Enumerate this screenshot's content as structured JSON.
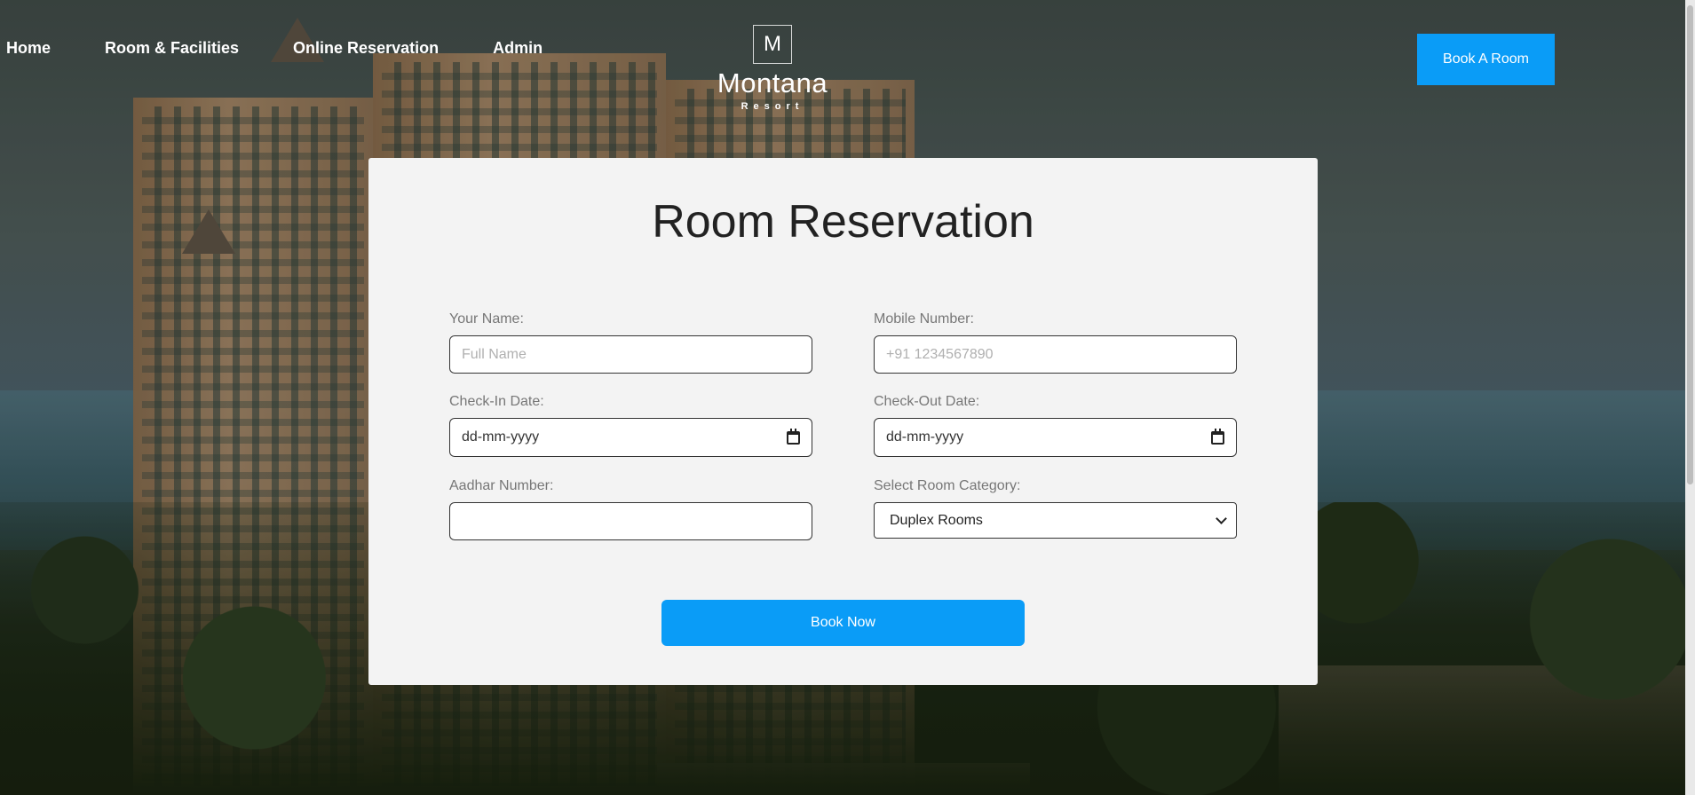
{
  "nav": {
    "items": [
      {
        "label": "Home"
      },
      {
        "label": "Room & Facilities"
      },
      {
        "label": "Online Reservation"
      },
      {
        "label": "Admin"
      }
    ]
  },
  "logo": {
    "mark": "M",
    "name": "Montana",
    "subtitle": "Resort"
  },
  "header": {
    "book_button_label": "Book A Room"
  },
  "form": {
    "title": "Room Reservation",
    "name": {
      "label": "Your Name:",
      "placeholder": "Full Name",
      "value": ""
    },
    "mobile": {
      "label": "Mobile Number:",
      "placeholder": "+91 1234567890",
      "value": ""
    },
    "checkin": {
      "label": "Check-In Date:",
      "value": "dd-mm-yyyy"
    },
    "checkout": {
      "label": "Check-Out Date:",
      "value": "dd-mm-yyyy"
    },
    "aadhar": {
      "label": "Aadhar Number:",
      "placeholder": "",
      "value": ""
    },
    "room_category": {
      "label": "Select Room Category:",
      "selected": "Duplex Rooms"
    },
    "submit_label": "Book Now"
  },
  "colors": {
    "accent": "#0a9cf7",
    "card_bg": "#f3f3f3"
  }
}
